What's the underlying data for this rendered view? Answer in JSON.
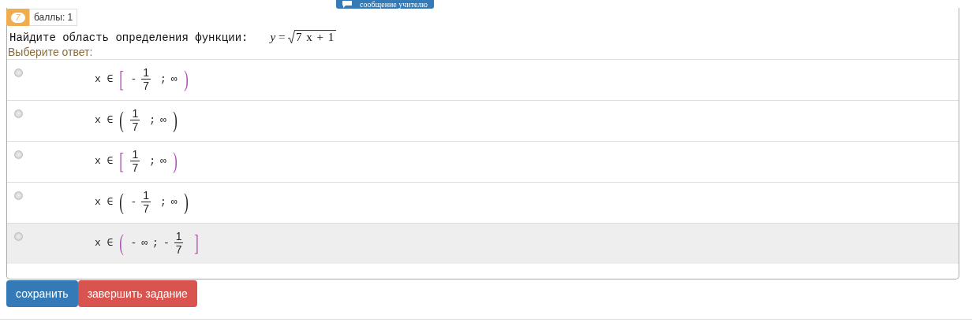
{
  "message_button": {
    "label": "сообщение учителю"
  },
  "task": {
    "number": "7",
    "score": "баллы: 1"
  },
  "question": {
    "text": "Найдите область определения функции:",
    "formula": {
      "lhs": "y",
      "eq": "=",
      "radicand": "7 x + 1"
    }
  },
  "prompt": "Выберите ответ:",
  "options": [
    {
      "selected": false,
      "highlighted": false,
      "var": "x ∈",
      "left": "[",
      "right": ")",
      "color": "#b050b0",
      "parts": [
        {
          "kind": "text",
          "text": "-"
        },
        {
          "kind": "frac",
          "num": "1",
          "den": "7"
        },
        {
          "kind": "text",
          "text": ";"
        },
        {
          "kind": "text",
          "text": "∞"
        }
      ]
    },
    {
      "selected": false,
      "highlighted": false,
      "var": "x ∈",
      "left": "(",
      "right": ")",
      "color": "#222222",
      "parts": [
        {
          "kind": "frac",
          "num": "1",
          "den": "7"
        },
        {
          "kind": "text",
          "text": ";"
        },
        {
          "kind": "text",
          "text": "∞"
        }
      ]
    },
    {
      "selected": false,
      "highlighted": false,
      "var": "x ∈",
      "left": "[",
      "right": ")",
      "color": "#b050b0",
      "parts": [
        {
          "kind": "frac",
          "num": "1",
          "den": "7"
        },
        {
          "kind": "text",
          "text": ";"
        },
        {
          "kind": "text",
          "text": "∞"
        }
      ]
    },
    {
      "selected": false,
      "highlighted": false,
      "var": "x ∈",
      "left": "(",
      "right": ")",
      "color": "#222222",
      "parts": [
        {
          "kind": "text",
          "text": "-"
        },
        {
          "kind": "frac",
          "num": "1",
          "den": "7"
        },
        {
          "kind": "text",
          "text": ";"
        },
        {
          "kind": "text",
          "text": "∞"
        }
      ]
    },
    {
      "selected": false,
      "highlighted": true,
      "var": "x ∈",
      "left": "(",
      "right": "]",
      "color": "#b050b0",
      "parts": [
        {
          "kind": "text",
          "text": "-"
        },
        {
          "kind": "text",
          "text": "∞"
        },
        {
          "kind": "text",
          "text": ";"
        },
        {
          "kind": "text",
          "text": "-"
        },
        {
          "kind": "frac",
          "num": "1",
          "den": "7"
        }
      ]
    }
  ],
  "buttons": [
    {
      "label": "сохранить",
      "kind": "primary"
    },
    {
      "label": "завершить задание",
      "kind": "danger"
    }
  ]
}
